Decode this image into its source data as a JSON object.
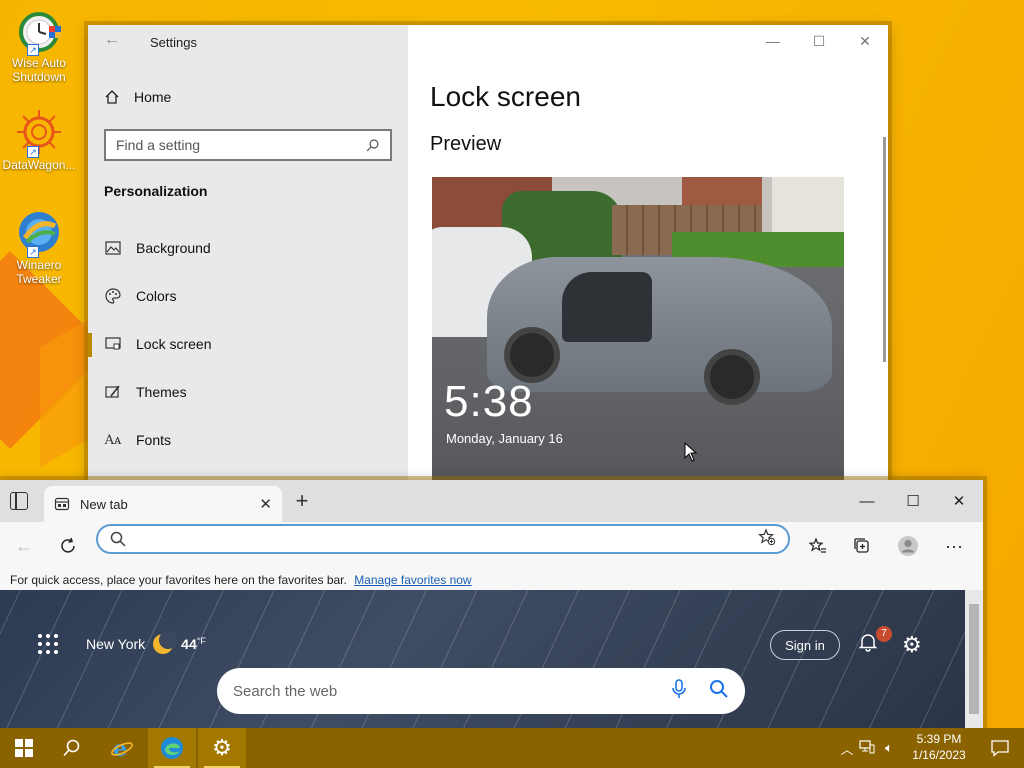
{
  "desktop": {
    "icons": [
      {
        "label": "Wise Auto Shutdown"
      },
      {
        "label": "DataWagon..."
      },
      {
        "label": "Winaero Tweaker"
      }
    ]
  },
  "settings": {
    "title": "Settings",
    "home": "Home",
    "search_placeholder": "Find a setting",
    "section": "Personalization",
    "nav": [
      {
        "label": "Background",
        "icon": "image-icon"
      },
      {
        "label": "Colors",
        "icon": "palette-icon"
      },
      {
        "label": "Lock screen",
        "icon": "lock-screen-icon"
      },
      {
        "label": "Themes",
        "icon": "themes-icon"
      },
      {
        "label": "Fonts",
        "icon": "fonts-icon"
      }
    ],
    "active_nav": "Lock screen",
    "page_title": "Lock screen",
    "subtitle": "Preview",
    "preview": {
      "time": "5:38",
      "date": "Monday, January 16"
    }
  },
  "edge": {
    "tab_title": "New tab",
    "favorites_message": "For quick access, place your favorites here on the favorites bar.",
    "manage_favorites": "Manage favorites now",
    "ntp": {
      "location": "New York",
      "temperature": "44",
      "temp_unit": "°F",
      "sign_in": "Sign in",
      "notification_count": "7",
      "search_placeholder": "Search the web"
    }
  },
  "taskbar": {
    "time": "5:39 PM",
    "date": "1/16/2023"
  },
  "colors": {
    "desktop": "#f7b500",
    "taskbar": "#8a6300",
    "accent": "#b78a00",
    "address_border": "#5b9bd5",
    "badge": "#c94b2e"
  }
}
